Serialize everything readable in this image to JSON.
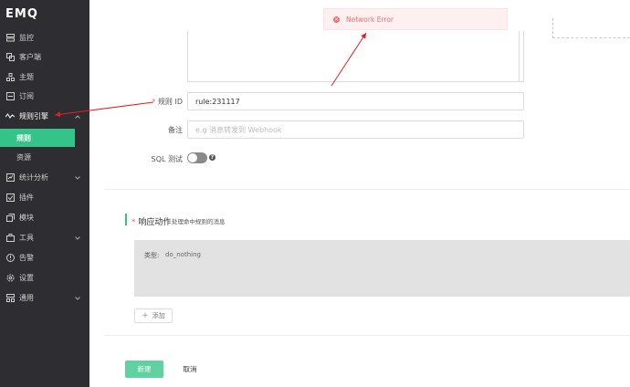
{
  "app": {
    "logo": "EMQ"
  },
  "sidebar": {
    "items": [
      {
        "label": "监控",
        "icon": "monitor-icon"
      },
      {
        "label": "客户端",
        "icon": "clients-icon"
      },
      {
        "label": "主题",
        "icon": "topics-icon"
      },
      {
        "label": "订阅",
        "icon": "subscriptions-icon"
      },
      {
        "label": "规则引擎",
        "icon": "rule-engine-icon",
        "expanded": true
      },
      {
        "label": "统计分析",
        "icon": "analysis-icon"
      },
      {
        "label": "插件",
        "icon": "plugins-icon"
      },
      {
        "label": "模块",
        "icon": "modules-icon"
      },
      {
        "label": "工具",
        "icon": "tools-icon"
      },
      {
        "label": "告警",
        "icon": "alarm-icon"
      },
      {
        "label": "设置",
        "icon": "settings-icon"
      },
      {
        "label": "通用",
        "icon": "general-icon"
      }
    ],
    "sub_items": [
      {
        "label": "规则",
        "active": true
      },
      {
        "label": "资源",
        "active": false
      }
    ]
  },
  "form": {
    "rule_id_label": "规则 ID",
    "rule_id_required_mark": "*",
    "rule_id_value": "rule:231117",
    "remark_label": "备注",
    "remark_placeholder": "e.g 消息转发到 Webhook",
    "sql_test_label": "SQL 测试",
    "sql_test_enabled": false,
    "help_glyph": "?"
  },
  "actions_section": {
    "required_mark": "*",
    "title": "响应动作",
    "subtitle": "处理命中规则的消息",
    "action_type_label": "类型:",
    "action_type_value": "do_nothing",
    "add_button": "添加"
  },
  "footer": {
    "create_button": "新建",
    "cancel_button": "取消"
  },
  "toast": {
    "message": "Network Error",
    "type": "error"
  },
  "colors": {
    "sidebar_bg": "#2e2e32",
    "accent": "#34c388",
    "error": "#f56c6c",
    "annotation_arrow": "#e02020"
  }
}
